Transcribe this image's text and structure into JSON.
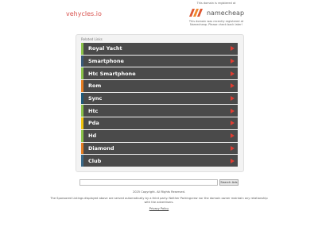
{
  "header": {
    "domain": "vehycles.io",
    "registrar_notice": "This domain is registered at",
    "registrar_name": "namecheap",
    "registrar_note": "This domain was recently registered at Namecheap. Please check back later!",
    "brand_color": "#de5833"
  },
  "panel": {
    "title": "Related Links",
    "links": [
      {
        "label": "Royal Yacht",
        "color": "#8bc34a"
      },
      {
        "label": "Smartphone",
        "color": "#3a5a7a"
      },
      {
        "label": "Htc Smartphone",
        "color": "#8bc34a"
      },
      {
        "label": "Rom",
        "color": "#e67e22"
      },
      {
        "label": "Sync",
        "color": "#1e5a7a"
      },
      {
        "label": "Htc",
        "color": "#8bc34a"
      },
      {
        "label": "Pda",
        "color": "#f1c40f"
      },
      {
        "label": "Hd",
        "color": "#8bc34a"
      },
      {
        "label": "Diamond",
        "color": "#e67e22"
      },
      {
        "label": "Club",
        "color": "#3a6a8a"
      }
    ]
  },
  "search": {
    "placeholder": "",
    "button_label": "Search Ads"
  },
  "footer": {
    "copyright": "2025 Copyright. All Rights Reserved.",
    "disclaimer": "The Sponsored Listings displayed above are served automatically by a third party. Neither Parkingcrew nor the domain owner maintain any relationship with the advertisers.",
    "privacy": "Privacy Policy"
  }
}
